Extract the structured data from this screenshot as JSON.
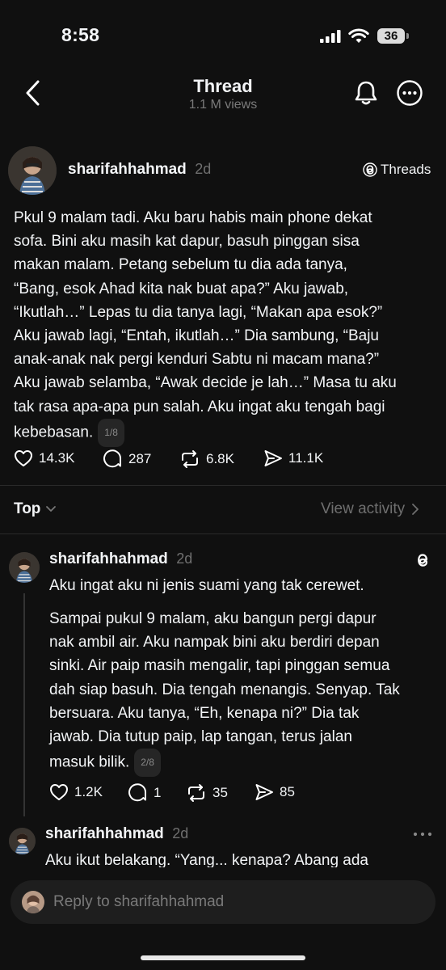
{
  "status_bar": {
    "time": "8:58",
    "battery": "36"
  },
  "header": {
    "title": "Thread",
    "views": "1.1 M views"
  },
  "post": {
    "username": "sharifahhahmad",
    "age": "2d",
    "source": "Threads",
    "text": "Pkul 9 malam tadi. Aku baru habis main phone dekat\nsofa. Bini aku masih kat dapur, basuh pinggan sisa\nmakan malam. Petang sebelum tu dia ada tanya,\n“Bang, esok Ahad kita nak buat apa?” Aku jawab,\n“Ikutlah…” Lepas tu dia tanya lagi, “Makan apa esok?”\nAku jawab lagi, “Entah, ikutlah…” Dia sambung, “Baju\nanak-anak nak pergi kenduri Sabtu ni macam mana?”\nAku jawab selamba, “Awak decide je lah…” Masa tu aku\ntak rasa apa-apa pun salah. Aku ingat aku tengah bagi\nkebebasan.",
    "page_badge": "1/8",
    "likes": "14.3K",
    "comments": "287",
    "reposts": "6.8K",
    "shares": "11.1K"
  },
  "sort": {
    "label": "Top",
    "view_activity": "View activity"
  },
  "reply1": {
    "username": "sharifahhahmad",
    "age": "2d",
    "line1": "Aku ingat aku ni jenis suami yang tak cerewet.",
    "text": "Sampai pukul 9 malam, aku bangun pergi dapur\nnak ambil air. Aku nampak bini aku berdiri depan\nsinki. Air paip masih mengalir, tapi pinggan semua\ndah siap basuh. Dia tengah menangis. Senyap. Tak\nbersuara. Aku tanya, “Eh, kenapa ni?” Dia tak\njawab. Dia tutup paip, lap tangan, terus jalan\nmasuk bilik.",
    "page_badge": "2/8",
    "likes": "1.2K",
    "comments": "1",
    "reposts": "35",
    "shares": "85"
  },
  "reply2": {
    "username": "sharifahhahmad",
    "age": "2d",
    "text": "Aku ikut belakang. “Yang... kenapa? Abang ada"
  },
  "composer": {
    "placeholder": "Reply to sharifahhahmad"
  },
  "icons": {
    "back": "chevron-left-icon",
    "bell": "bell-icon",
    "more": "more-icon",
    "threads": "threads-logo-icon",
    "heart": "heart-icon",
    "comment": "comment-icon",
    "repost": "repost-icon",
    "share": "share-icon"
  },
  "colors": {
    "background": "#101010",
    "text": "#f3f5f7",
    "muted": "#777777"
  }
}
